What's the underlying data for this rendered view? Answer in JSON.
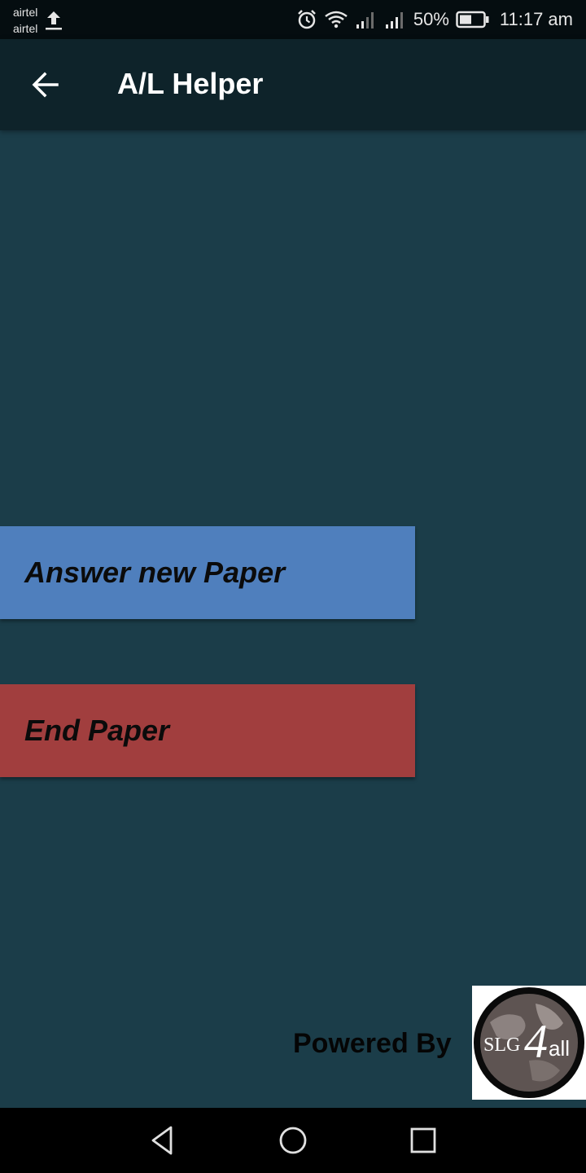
{
  "status_bar": {
    "carrier_1": "airtel",
    "carrier_2": "airtel",
    "battery": "50%",
    "time": "11:17 am",
    "icons": [
      "upload-icon",
      "alarm-icon",
      "wifi-icon",
      "signal-icon",
      "signal-icon",
      "battery-icon"
    ]
  },
  "app_bar": {
    "title": "A/L Helper",
    "back_icon": "arrow-left-icon"
  },
  "main": {
    "answer_button": {
      "label": "Answer new Paper",
      "color": "#4f7fbd"
    },
    "end_button": {
      "label": "End Paper",
      "color": "#a13e3e"
    }
  },
  "footer": {
    "powered_by": "Powered By",
    "logo_text_main": "SLG",
    "logo_text_num": "4",
    "logo_text_suffix": "all"
  },
  "nav_bar": {
    "icons": [
      "back-triangle-icon",
      "home-circle-icon",
      "recents-square-icon"
    ]
  },
  "colors": {
    "background": "#1b3d49",
    "app_bar": "#0e232a",
    "status_bar": "#050d10"
  }
}
